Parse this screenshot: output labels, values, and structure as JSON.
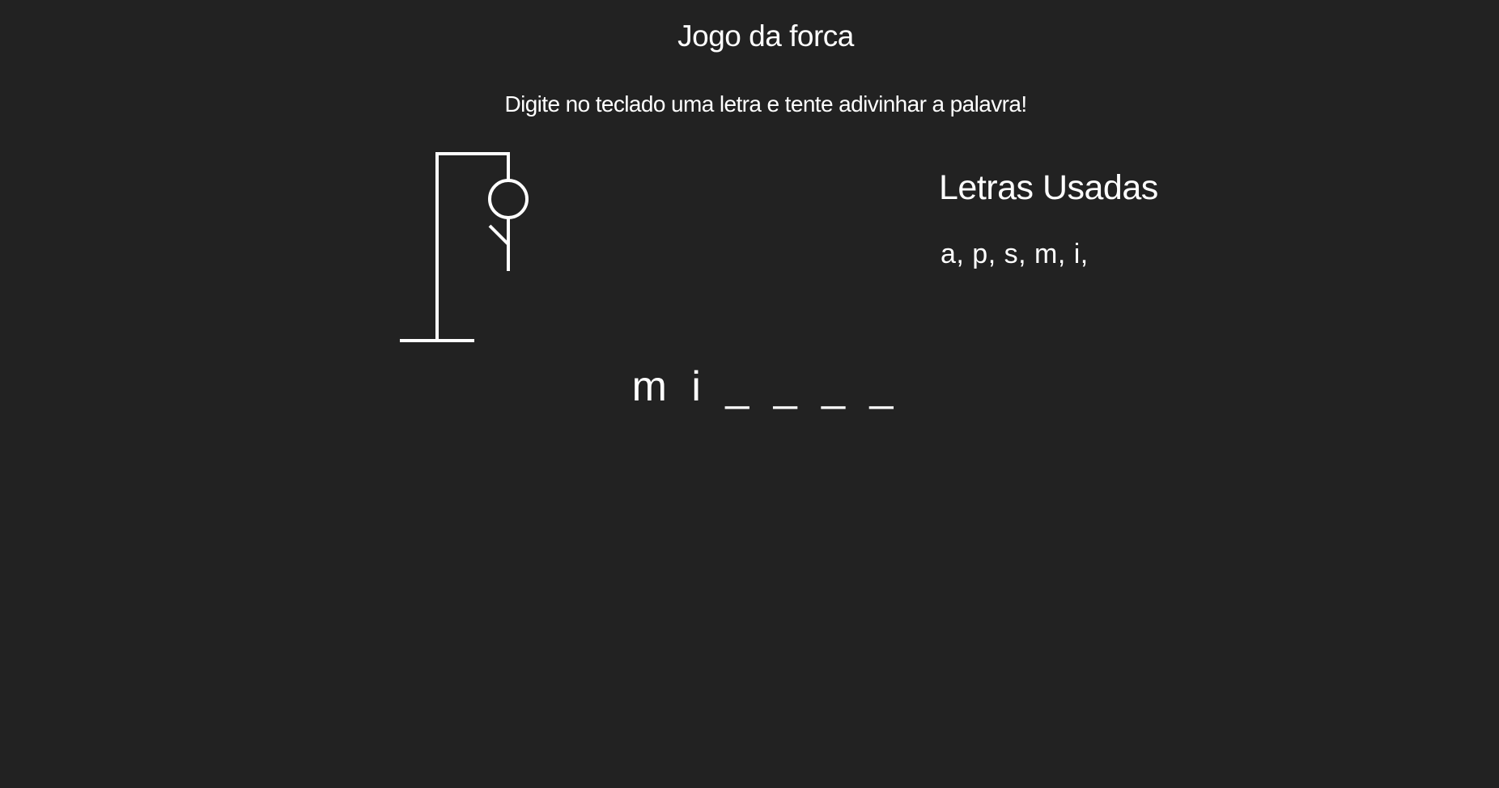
{
  "game": {
    "title": "Jogo da forca",
    "instructions": "Digite no teclado uma letra e tente adivinhar a palavra!"
  },
  "used_letters": {
    "title": "Letras Usadas",
    "list": "a, p, s, m, i,"
  },
  "word_display": "m i _ _ _ _",
  "hangman": {
    "stroke_color": "#ffffff",
    "background_color": "#222222",
    "parts_drawn": [
      "gallows",
      "head",
      "body",
      "left-arm"
    ]
  }
}
